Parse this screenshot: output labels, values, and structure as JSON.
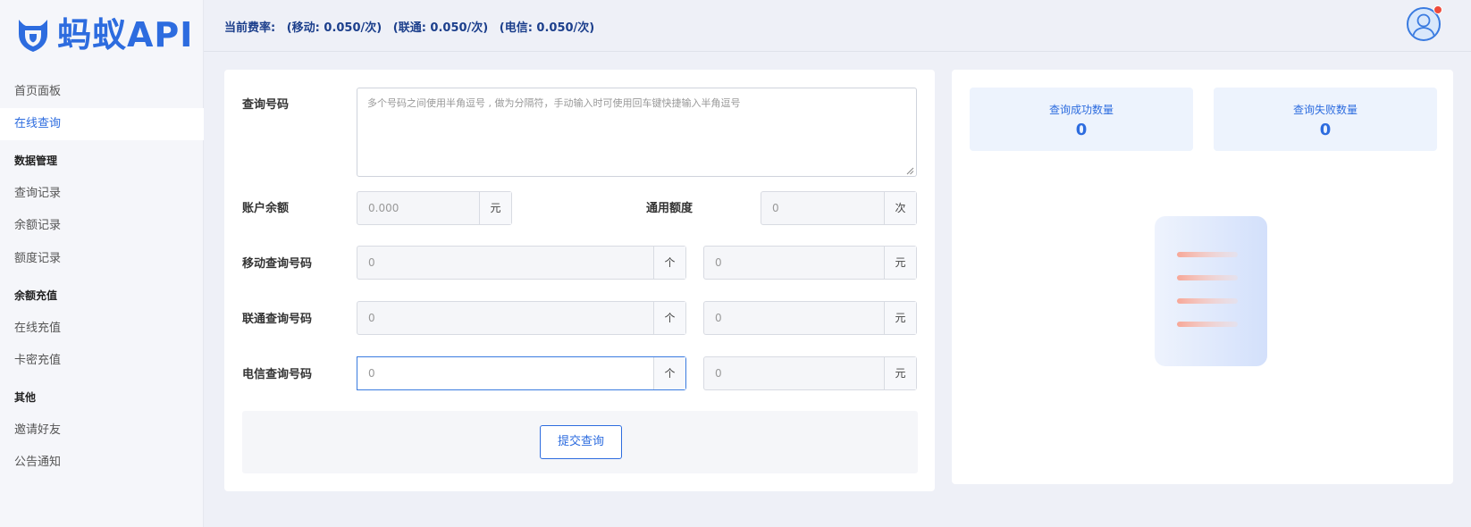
{
  "brand": {
    "logo_text": "蚂蚁API",
    "accent": "#2d6cdf"
  },
  "sidebar": {
    "items": [
      {
        "label": "首页面板",
        "type": "item"
      },
      {
        "label": "在线查询",
        "type": "item",
        "active": true
      },
      {
        "label": "数据管理",
        "type": "group"
      },
      {
        "label": "查询记录",
        "type": "item"
      },
      {
        "label": "余额记录",
        "type": "item"
      },
      {
        "label": "额度记录",
        "type": "item"
      },
      {
        "label": "余额充值",
        "type": "group"
      },
      {
        "label": "在线充值",
        "type": "item"
      },
      {
        "label": "卡密充值",
        "type": "item"
      },
      {
        "label": "其他",
        "type": "group"
      },
      {
        "label": "邀请好友",
        "type": "item"
      },
      {
        "label": "公告通知",
        "type": "item"
      }
    ]
  },
  "header": {
    "rate_prefix": "当前费率:",
    "rates": [
      "(移动: 0.050/次)",
      "(联通: 0.050/次)",
      "(电信: 0.050/次)"
    ],
    "avatar_icon": "user-avatar-icon",
    "notification_dot_color": "#ef4b3c"
  },
  "form": {
    "query_numbers_label": "查询号码",
    "query_numbers_placeholder": "多个号码之间使用半角逗号 , 做为分隔符，手动输入时可使用回车键快捷输入半角逗号",
    "balance_label": "账户余额",
    "balance_placeholder": "0.000",
    "balance_unit": "元",
    "quota_label": "通用额度",
    "quota_placeholder": "0",
    "quota_unit": "次",
    "carriers": [
      {
        "label": "移动查询号码",
        "count_placeholder": "0",
        "count_unit": "个",
        "cost_placeholder": "0",
        "cost_unit": "元"
      },
      {
        "label": "联通查询号码",
        "count_placeholder": "0",
        "count_unit": "个",
        "cost_placeholder": "0",
        "cost_unit": "元"
      },
      {
        "label": "电信查询号码",
        "count_placeholder": "0",
        "count_unit": "个",
        "cost_placeholder": "0",
        "cost_unit": "元",
        "focused": true
      }
    ],
    "submit_label": "提交查询"
  },
  "stats": {
    "success_label": "查询成功数量",
    "success_value": "0",
    "fail_label": "查询失败数量",
    "fail_value": "0",
    "illustration_icon": "document-list-icon"
  }
}
